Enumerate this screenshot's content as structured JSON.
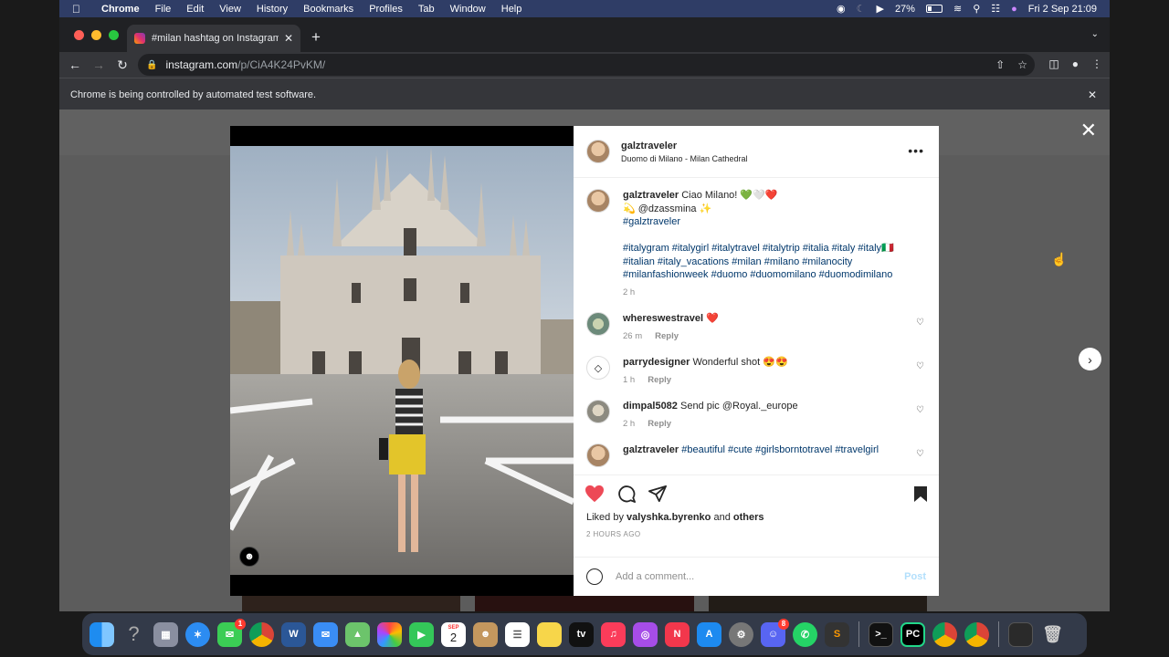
{
  "menubar": {
    "app_name": "Chrome",
    "items": [
      "File",
      "Edit",
      "View",
      "History",
      "Bookmarks",
      "Profiles",
      "Tab",
      "Window",
      "Help"
    ],
    "battery": "27%",
    "datetime": "Fri 2 Sep  21:09"
  },
  "browser": {
    "tab_title": "#milan hashtag on Instagram",
    "url_host": "instagram.com",
    "url_path": "/p/CiA4K24PvKM/",
    "infobar_text": "Chrome is being controlled by automated test software."
  },
  "post": {
    "author": "galztraveler",
    "location": "Duomo di Milano - Milan Cathedral",
    "caption": {
      "line1": "Ciao Milano! 💚🤍❤️",
      "line2": "💫 @dzassmina ✨",
      "line3": "#galztraveler",
      "hashtags_1": "#italygram #italygirl #italytravel #italytrip #italia #italy #italy🇮🇹",
      "hashtags_2": "#italian #italy_vacations #milan #milano #milanocity",
      "hashtags_3": "#milanfashionweek #duomo #duomomilano #duomodimilano",
      "time": "2 h"
    },
    "comments": [
      {
        "user": "whereswestravel",
        "text": "❤️",
        "time": "26 m",
        "reply": "Reply"
      },
      {
        "user": "parrydesigner",
        "text": "Wonderful shot 😍😍",
        "time": "1 h",
        "reply": "Reply"
      },
      {
        "user": "dimpal5082",
        "text": "Send pic @Royal._europe",
        "time": "2 h",
        "reply": "Reply"
      },
      {
        "user": "galztraveler",
        "text": "#beautiful #cute #girlsborntotravel #travelgirl"
      }
    ],
    "liked_by_prefix": "Liked by",
    "liked_by_user": "valyshka.byrenko",
    "liked_by_and": "and",
    "liked_by_others": "others",
    "time_ago": "2 HOURS AGO",
    "comment_placeholder": "Add a comment...",
    "post_button": "Post"
  },
  "dock": {
    "badges": {
      "messages": "1",
      "discord": "8"
    },
    "calendar_month": "SEP",
    "calendar_day": "2"
  },
  "colors": {
    "menubar": "#2f3d66",
    "like_red": "#ed4956",
    "link_blue": "#00376b",
    "post_disabled": "#b2dffc"
  }
}
